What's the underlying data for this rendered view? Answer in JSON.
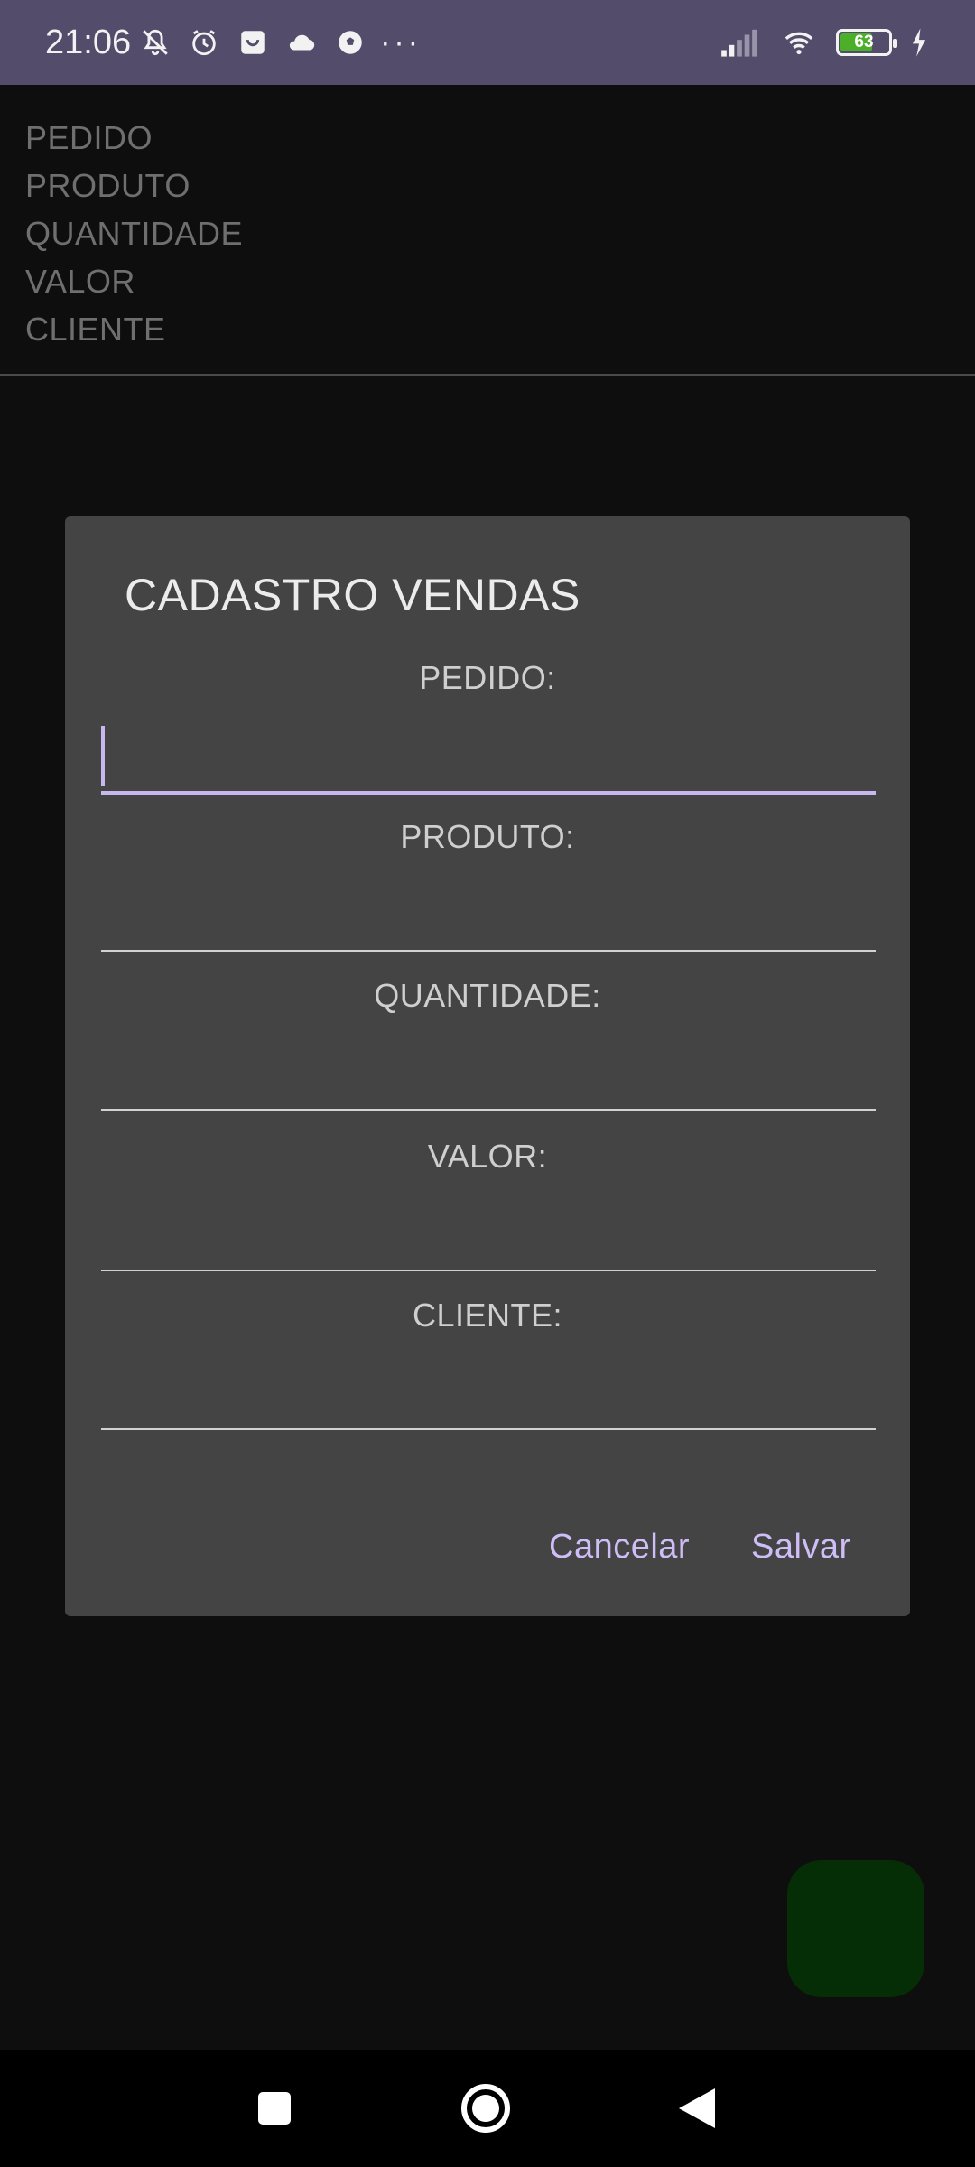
{
  "status_bar": {
    "time": "21:06",
    "battery_level": "63",
    "background_color": "#544c6b",
    "icons_left": [
      "notifications-off-icon",
      "alarm-icon",
      "shopping-bag-icon",
      "cloud-icon",
      "soccer-ball-icon"
    ],
    "more": "···",
    "icons_right": [
      "signal-icon",
      "wifi-icon",
      "battery-icon",
      "charging-bolt-icon"
    ]
  },
  "background_list": {
    "items": [
      "PEDIDO",
      "PRODUTO",
      "QUANTIDADE",
      "VALOR",
      "CLIENTE"
    ]
  },
  "dialog": {
    "title": "CADASTRO VENDAS",
    "fields": [
      {
        "label": "PEDIDO:",
        "value": "",
        "focused": true
      },
      {
        "label": "PRODUTO:",
        "value": "",
        "focused": false
      },
      {
        "label": "QUANTIDADE:",
        "value": "",
        "focused": false
      },
      {
        "label": "VALOR:",
        "value": "",
        "focused": false
      },
      {
        "label": "CLIENTE:",
        "value": "",
        "focused": false
      }
    ],
    "cancel_label": "Cancelar",
    "save_label": "Salvar",
    "accent_color": "#cfbdf7"
  },
  "fab": {
    "color": "#062e06"
  },
  "nav_bar": {
    "buttons": [
      "recent-apps-icon",
      "home-icon",
      "back-icon"
    ]
  }
}
